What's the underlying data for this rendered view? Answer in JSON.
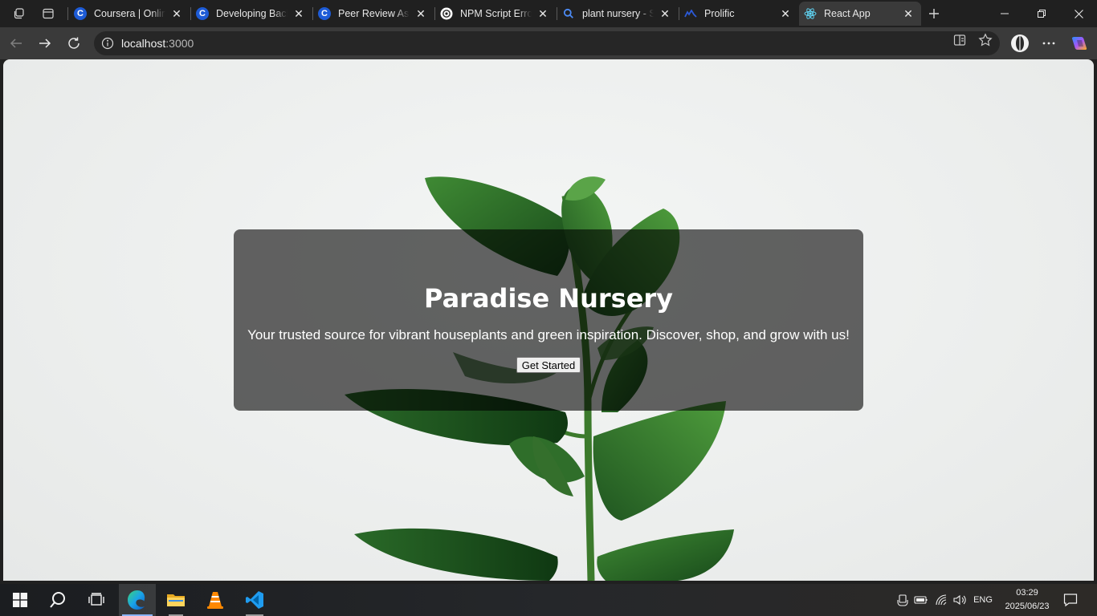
{
  "browser": {
    "tabs": [
      {
        "title": "Coursera | Online",
        "favicon": "coursera-icon"
      },
      {
        "title": "Developing Back",
        "favicon": "coursera-icon"
      },
      {
        "title": "Peer Review Assic",
        "favicon": "coursera-icon"
      },
      {
        "title": "NPM Script Error",
        "favicon": "chatgpt-icon"
      },
      {
        "title": "plant nursery - Se",
        "favicon": "search-icon"
      },
      {
        "title": "Prolific",
        "favicon": "prolific-icon"
      },
      {
        "title": "React App",
        "favicon": "react-icon",
        "active": true
      }
    ],
    "address": {
      "host": "localhost",
      "port": ":3000"
    }
  },
  "page": {
    "title": "Paradise Nursery",
    "subtitle": "Your trusted source for vibrant houseplants and green inspiration. Discover, shop, and grow with us!",
    "cta_label": "Get Started"
  },
  "taskbar": {
    "time": "03:29",
    "date": "2025/06/23",
    "language": "ENG",
    "pinned": [
      "start-icon",
      "search-icon",
      "task-view-icon",
      "edge-icon",
      "file-explorer-icon",
      "vlc-icon",
      "vscode-icon"
    ]
  },
  "colors": {
    "accent": "#1d5bd6",
    "leaf": "#2e6b2a",
    "overlay": "rgba(0,0,0,0.6)"
  }
}
